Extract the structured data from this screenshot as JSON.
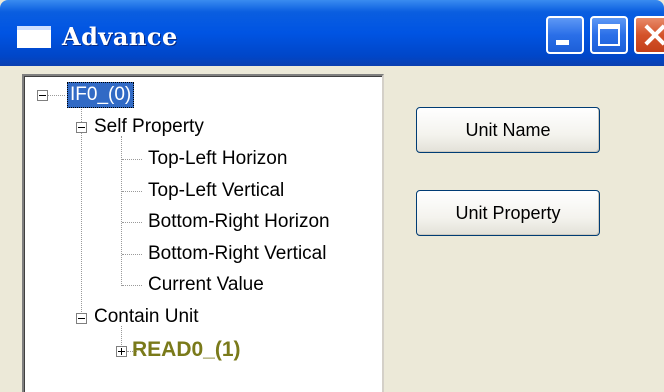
{
  "window": {
    "title": "Advance"
  },
  "title_buttons": {
    "minimize_icon": "minimize-icon",
    "maximize_icon": "maximize-icon",
    "close_icon": "close-icon"
  },
  "tree": {
    "root": {
      "label": "IF0_(0)",
      "selected": true
    },
    "nodes": [
      {
        "label": "Self Property",
        "expanded": true,
        "children": [
          "Top-Left Horizon",
          "Top-Left Vertical",
          "Bottom-Right Horizon",
          "Bottom-Right Vertical",
          "Current Value"
        ]
      },
      {
        "label": "Contain Unit",
        "expanded": true,
        "children": [
          {
            "label": "READ0_(1)",
            "expanded": false
          }
        ]
      }
    ]
  },
  "buttons": {
    "unit_name": "Unit Name",
    "unit_property": "Unit Property"
  },
  "colors": {
    "titlebar": "#0054e3",
    "selection": "#316ac5",
    "read_node_text": "#7a7a1a",
    "window_bg": "#ece9d8"
  }
}
